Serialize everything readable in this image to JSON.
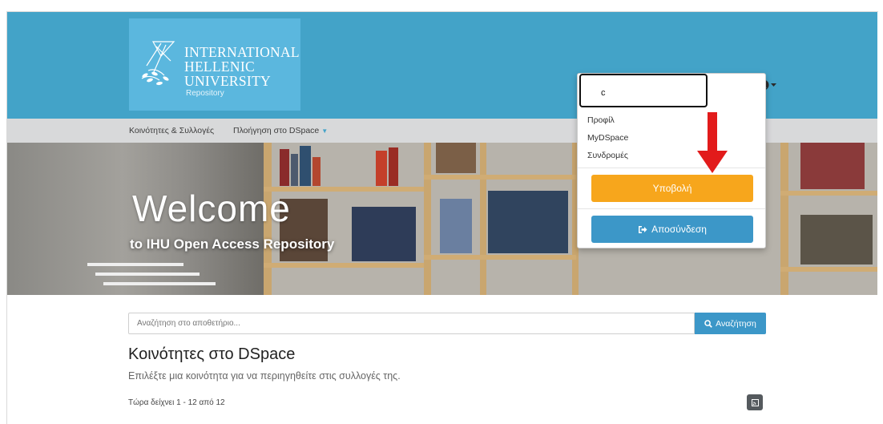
{
  "header": {
    "logo_line1": "INTERNATIONAL",
    "logo_line2": "HELLENIC",
    "logo_line3": "UNIVERSITY",
    "logo_sub": "Repository",
    "icons": [
      "search-icon",
      "globe-icon",
      "user-icon",
      "caret-down-icon"
    ]
  },
  "nav": {
    "communities": "Κοινότητες & Συλλογές",
    "browse": "Πλοήγηση στο DSpace"
  },
  "hero": {
    "title": "Welcome",
    "subtitle": "to IHU Open Access Repository"
  },
  "user_menu": {
    "username": "c",
    "items": [
      "Προφίλ",
      "MyDSpace",
      "Συνδρομές"
    ],
    "submit_label": "Υποβολή",
    "logout_label": "Αποσύνδεση"
  },
  "search": {
    "placeholder": "Αναζήτηση στο αποθετήριο...",
    "button_label": "Αναζήτηση"
  },
  "main": {
    "heading": "Κοινότητες στο DSpace",
    "description": "Επιλέξτε μια κοινότητα για να περιηγηθείτε στις συλλογές της.",
    "count": "Τώρα δείχνει 1 - 12 από 12"
  },
  "colors": {
    "header_bg": "#43a3c8",
    "logo_bg": "#5bb7de",
    "navbar_bg": "#d8d9da",
    "submit_button": "#f7a61c",
    "primary_button": "#3c97c8",
    "annotation_arrow": "#e21b1b"
  }
}
